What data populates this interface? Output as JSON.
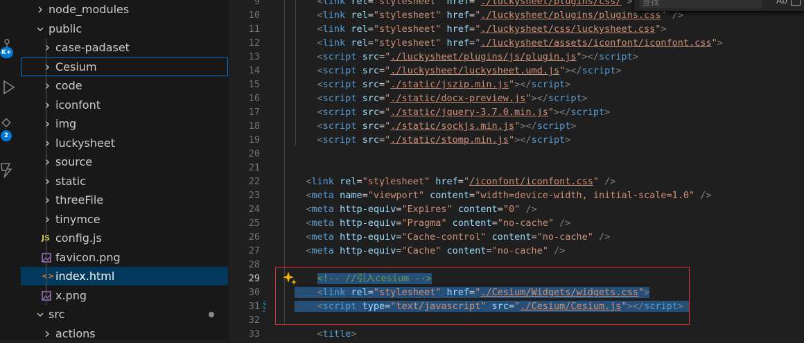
{
  "activity": {
    "badge_top": "K+",
    "badge_bottom": "2"
  },
  "explorer": {
    "items": [
      {
        "label": "node_modules",
        "kind": "folder",
        "expanded": false,
        "depth": 1
      },
      {
        "label": "public",
        "kind": "folder",
        "expanded": true,
        "depth": 1
      },
      {
        "label": "case-padaset",
        "kind": "folder",
        "expanded": false,
        "depth": 2
      },
      {
        "label": "Cesium",
        "kind": "folder",
        "expanded": false,
        "depth": 2
      },
      {
        "label": "code",
        "kind": "folder",
        "expanded": false,
        "depth": 2
      },
      {
        "label": "iconfont",
        "kind": "folder",
        "expanded": false,
        "depth": 2
      },
      {
        "label": "img",
        "kind": "folder",
        "expanded": false,
        "depth": 2
      },
      {
        "label": "luckysheet",
        "kind": "folder",
        "expanded": false,
        "depth": 2
      },
      {
        "label": "source",
        "kind": "folder",
        "expanded": false,
        "depth": 2
      },
      {
        "label": "static",
        "kind": "folder",
        "expanded": false,
        "depth": 2
      },
      {
        "label": "threeFile",
        "kind": "folder",
        "expanded": false,
        "depth": 2
      },
      {
        "label": "tinymce",
        "kind": "folder",
        "expanded": false,
        "depth": 2
      },
      {
        "label": "config.js",
        "kind": "js",
        "icon_text": "JS",
        "depth": 2
      },
      {
        "label": "favicon.png",
        "kind": "image",
        "depth": 2
      },
      {
        "label": "index.html",
        "kind": "html",
        "icon_text": "<>",
        "depth": 2
      },
      {
        "label": "x.png",
        "kind": "image",
        "depth": 2
      },
      {
        "label": "src",
        "kind": "folder",
        "expanded": true,
        "depth": 1,
        "modified": true
      },
      {
        "label": "actions",
        "kind": "folder",
        "expanded": false,
        "depth": 2
      }
    ]
  },
  "find_widget": {
    "placeholder": "查找",
    "match_case_label": "Ab"
  },
  "editor": {
    "active_line": "29",
    "lines": [
      {
        "n": "9",
        "tokens": [
          [
            "i",
            "    "
          ],
          [
            "tag",
            "<"
          ],
          [
            "tn",
            "link"
          ],
          [
            "p",
            " "
          ],
          [
            "at",
            "rel"
          ],
          [
            "p",
            "="
          ],
          [
            "st",
            "\"stylesheet\""
          ],
          [
            "p",
            " "
          ],
          [
            "at",
            "href"
          ],
          [
            "p",
            "="
          ],
          [
            "st",
            "\""
          ],
          [
            "url",
            "./luckysheet/plugins/css/"
          ],
          [
            "st",
            "\""
          ],
          [
            "tag",
            ">"
          ]
        ]
      },
      {
        "n": "10",
        "tokens": [
          [
            "i",
            "    "
          ],
          [
            "tag",
            "<"
          ],
          [
            "tn",
            "link"
          ],
          [
            "p",
            " "
          ],
          [
            "at",
            "rel"
          ],
          [
            "p",
            "="
          ],
          [
            "st",
            "\"stylesheet\""
          ],
          [
            "p",
            " "
          ],
          [
            "at",
            "href"
          ],
          [
            "p",
            "="
          ],
          [
            "st",
            "\""
          ],
          [
            "url",
            "./luckysheet/plugins/plugins.css"
          ],
          [
            "st",
            "\""
          ],
          [
            "tag",
            " />"
          ]
        ]
      },
      {
        "n": "11",
        "tokens": [
          [
            "i",
            "    "
          ],
          [
            "tag",
            "<"
          ],
          [
            "tn",
            "link"
          ],
          [
            "p",
            " "
          ],
          [
            "at",
            "rel"
          ],
          [
            "p",
            "="
          ],
          [
            "st",
            "\"stylesheet\""
          ],
          [
            "p",
            " "
          ],
          [
            "at",
            "href"
          ],
          [
            "p",
            "="
          ],
          [
            "st",
            "\""
          ],
          [
            "url",
            "./luckysheet/css/luckysheet.css"
          ],
          [
            "st",
            "\""
          ],
          [
            "tag",
            ">"
          ]
        ]
      },
      {
        "n": "12",
        "tokens": [
          [
            "i",
            "    "
          ],
          [
            "tag",
            "<"
          ],
          [
            "tn",
            "link"
          ],
          [
            "p",
            " "
          ],
          [
            "at",
            "rel"
          ],
          [
            "p",
            "="
          ],
          [
            "st",
            "\"stylesheet\""
          ],
          [
            "p",
            " "
          ],
          [
            "at",
            "href"
          ],
          [
            "p",
            "="
          ],
          [
            "st",
            "\""
          ],
          [
            "url",
            "./luckysheet/assets/iconfont/iconfont.css"
          ],
          [
            "st",
            "\""
          ],
          [
            "tag",
            ">"
          ]
        ]
      },
      {
        "n": "13",
        "tokens": [
          [
            "i",
            "    "
          ],
          [
            "tag",
            "<"
          ],
          [
            "tn",
            "script"
          ],
          [
            "p",
            " "
          ],
          [
            "at",
            "src"
          ],
          [
            "p",
            "="
          ],
          [
            "st",
            "\""
          ],
          [
            "url",
            "./luckysheet/plugins/js/plugin.js"
          ],
          [
            "st",
            "\""
          ],
          [
            "tag",
            "></"
          ],
          [
            "tn",
            "script"
          ],
          [
            "tag",
            ">"
          ]
        ]
      },
      {
        "n": "14",
        "tokens": [
          [
            "i",
            "    "
          ],
          [
            "tag",
            "<"
          ],
          [
            "tn",
            "script"
          ],
          [
            "p",
            " "
          ],
          [
            "at",
            "src"
          ],
          [
            "p",
            "="
          ],
          [
            "st",
            "\""
          ],
          [
            "url",
            "./luckysheet/luckysheet.umd.js"
          ],
          [
            "st",
            "\""
          ],
          [
            "tag",
            "></"
          ],
          [
            "tn",
            "script"
          ],
          [
            "tag",
            ">"
          ]
        ]
      },
      {
        "n": "15",
        "tokens": [
          [
            "i",
            "    "
          ],
          [
            "tag",
            "<"
          ],
          [
            "tn",
            "script"
          ],
          [
            "p",
            " "
          ],
          [
            "at",
            "src"
          ],
          [
            "p",
            "="
          ],
          [
            "st",
            "\""
          ],
          [
            "url",
            "./static/jszip.min.js"
          ],
          [
            "st",
            "\""
          ],
          [
            "tag",
            "></"
          ],
          [
            "tn",
            "script"
          ],
          [
            "tag",
            ">"
          ]
        ]
      },
      {
        "n": "16",
        "tokens": [
          [
            "i",
            "    "
          ],
          [
            "tag",
            "<"
          ],
          [
            "tn",
            "script"
          ],
          [
            "p",
            " "
          ],
          [
            "at",
            "src"
          ],
          [
            "p",
            "="
          ],
          [
            "st",
            "\""
          ],
          [
            "url",
            "./static/docx-preview.js"
          ],
          [
            "st",
            "\""
          ],
          [
            "tag",
            "></"
          ],
          [
            "tn",
            "script"
          ],
          [
            "tag",
            ">"
          ]
        ]
      },
      {
        "n": "17",
        "tokens": [
          [
            "i",
            "    "
          ],
          [
            "tag",
            "<"
          ],
          [
            "tn",
            "script"
          ],
          [
            "p",
            " "
          ],
          [
            "at",
            "src"
          ],
          [
            "p",
            "="
          ],
          [
            "st",
            "\""
          ],
          [
            "url",
            "./static/jquery-3.7.0.min.js"
          ],
          [
            "st",
            "\""
          ],
          [
            "tag",
            "></"
          ],
          [
            "tn",
            "script"
          ],
          [
            "tag",
            ">"
          ]
        ]
      },
      {
        "n": "18",
        "tokens": [
          [
            "i",
            "    "
          ],
          [
            "tag",
            "<"
          ],
          [
            "tn",
            "script"
          ],
          [
            "p",
            " "
          ],
          [
            "at",
            "src"
          ],
          [
            "p",
            "="
          ],
          [
            "st",
            "\""
          ],
          [
            "url",
            "./static/sockjs.min.js"
          ],
          [
            "st",
            "\""
          ],
          [
            "tag",
            "></"
          ],
          [
            "tn",
            "script"
          ],
          [
            "tag",
            ">"
          ]
        ]
      },
      {
        "n": "19",
        "tokens": [
          [
            "i",
            "    "
          ],
          [
            "tag",
            "<"
          ],
          [
            "tn",
            "script"
          ],
          [
            "p",
            " "
          ],
          [
            "at",
            "src"
          ],
          [
            "p",
            "="
          ],
          [
            "st",
            "\""
          ],
          [
            "url",
            "./static/stomp.min.js"
          ],
          [
            "st",
            "\""
          ],
          [
            "tag",
            "></"
          ],
          [
            "tn",
            "script"
          ],
          [
            "tag",
            ">"
          ]
        ]
      },
      {
        "n": "20",
        "tokens": []
      },
      {
        "n": "21",
        "tokens": []
      },
      {
        "n": "22",
        "tokens": [
          [
            "i",
            "  "
          ],
          [
            "tag",
            "<"
          ],
          [
            "tn",
            "link"
          ],
          [
            "p",
            " "
          ],
          [
            "at",
            "rel"
          ],
          [
            "p",
            "="
          ],
          [
            "st",
            "\"stylesheet\""
          ],
          [
            "p",
            " "
          ],
          [
            "at",
            "href"
          ],
          [
            "p",
            "="
          ],
          [
            "st",
            "\""
          ],
          [
            "url",
            "/iconfont/iconfont.css"
          ],
          [
            "st",
            "\""
          ],
          [
            "tag",
            " />"
          ]
        ]
      },
      {
        "n": "23",
        "tokens": [
          [
            "i",
            "  "
          ],
          [
            "tag",
            "<"
          ],
          [
            "tn",
            "meta"
          ],
          [
            "p",
            " "
          ],
          [
            "at",
            "name"
          ],
          [
            "p",
            "="
          ],
          [
            "st",
            "\"viewport\""
          ],
          [
            "p",
            " "
          ],
          [
            "at",
            "content"
          ],
          [
            "p",
            "="
          ],
          [
            "st",
            "\"width=device-width, initial-scale=1.0\""
          ],
          [
            "tag",
            " />"
          ]
        ]
      },
      {
        "n": "24",
        "tokens": [
          [
            "i",
            "  "
          ],
          [
            "tag",
            "<"
          ],
          [
            "tn",
            "meta"
          ],
          [
            "p",
            " "
          ],
          [
            "at",
            "http-equiv"
          ],
          [
            "p",
            "="
          ],
          [
            "st",
            "\"Expires\""
          ],
          [
            "p",
            " "
          ],
          [
            "at",
            "content"
          ],
          [
            "p",
            "="
          ],
          [
            "st",
            "\"0\""
          ],
          [
            "tag",
            " />"
          ]
        ]
      },
      {
        "n": "25",
        "tokens": [
          [
            "i",
            "  "
          ],
          [
            "tag",
            "<"
          ],
          [
            "tn",
            "meta"
          ],
          [
            "p",
            " "
          ],
          [
            "at",
            "http-equiv"
          ],
          [
            "p",
            "="
          ],
          [
            "st",
            "\"Pragma\""
          ],
          [
            "p",
            " "
          ],
          [
            "at",
            "content"
          ],
          [
            "p",
            "="
          ],
          [
            "st",
            "\"no-cache\""
          ],
          [
            "tag",
            " />"
          ]
        ]
      },
      {
        "n": "26",
        "tokens": [
          [
            "i",
            "  "
          ],
          [
            "tag",
            "<"
          ],
          [
            "tn",
            "meta"
          ],
          [
            "p",
            " "
          ],
          [
            "at",
            "http-equiv"
          ],
          [
            "p",
            "="
          ],
          [
            "st",
            "\"Cache-control\""
          ],
          [
            "p",
            " "
          ],
          [
            "at",
            "content"
          ],
          [
            "p",
            "="
          ],
          [
            "st",
            "\"no-cache\""
          ],
          [
            "tag",
            " />"
          ]
        ]
      },
      {
        "n": "27",
        "tokens": [
          [
            "i",
            "  "
          ],
          [
            "tag",
            "<"
          ],
          [
            "tn",
            "meta"
          ],
          [
            "p",
            " "
          ],
          [
            "at",
            "http-equiv"
          ],
          [
            "p",
            "="
          ],
          [
            "st",
            "\"Cache\""
          ],
          [
            "p",
            " "
          ],
          [
            "at",
            "content"
          ],
          [
            "p",
            "="
          ],
          [
            "st",
            "\"no-cache\""
          ],
          [
            "tag",
            " />"
          ]
        ]
      },
      {
        "n": "28",
        "tokens": []
      },
      {
        "n": "29",
        "sel": true,
        "tokens": [
          [
            "i",
            "    "
          ],
          [
            "cm",
            "<!-- //引入cesium -->"
          ]
        ]
      },
      {
        "n": "30",
        "sel": true,
        "tokens": [
          [
            "ws",
            "→   "
          ],
          [
            "tag",
            "<"
          ],
          [
            "tn",
            "link"
          ],
          [
            "p",
            " "
          ],
          [
            "at",
            "rel"
          ],
          [
            "p",
            "="
          ],
          [
            "st",
            "\"stylesheet\""
          ],
          [
            "p",
            " "
          ],
          [
            "at",
            "href"
          ],
          [
            "p",
            "="
          ],
          [
            "st",
            "\""
          ],
          [
            "url",
            "./Cesium/Widgets/widgets.css"
          ],
          [
            "st",
            "\""
          ],
          [
            "tag",
            ">"
          ]
        ]
      },
      {
        "n": "31",
        "sel": true,
        "tokens": [
          [
            "ws",
            "→   "
          ],
          [
            "tag",
            "<"
          ],
          [
            "tn",
            "script"
          ],
          [
            "p",
            " "
          ],
          [
            "at",
            "type"
          ],
          [
            "p",
            "="
          ],
          [
            "st",
            "\"text/javascript\""
          ],
          [
            "p",
            " "
          ],
          [
            "at",
            "src"
          ],
          [
            "p",
            "="
          ],
          [
            "st",
            "\""
          ],
          [
            "url",
            "./Cesium/Cesium.js"
          ],
          [
            "st",
            "\""
          ],
          [
            "tag",
            "></"
          ],
          [
            "tn",
            "script"
          ],
          [
            "tag",
            ">"
          ],
          [
            "ws",
            "·"
          ]
        ]
      },
      {
        "n": "32",
        "tokens": []
      },
      {
        "n": "33",
        "tokens": [
          [
            "i",
            "    "
          ],
          [
            "tag",
            "<"
          ],
          [
            "tn",
            "title"
          ],
          [
            "tag",
            ">"
          ]
        ]
      }
    ]
  }
}
